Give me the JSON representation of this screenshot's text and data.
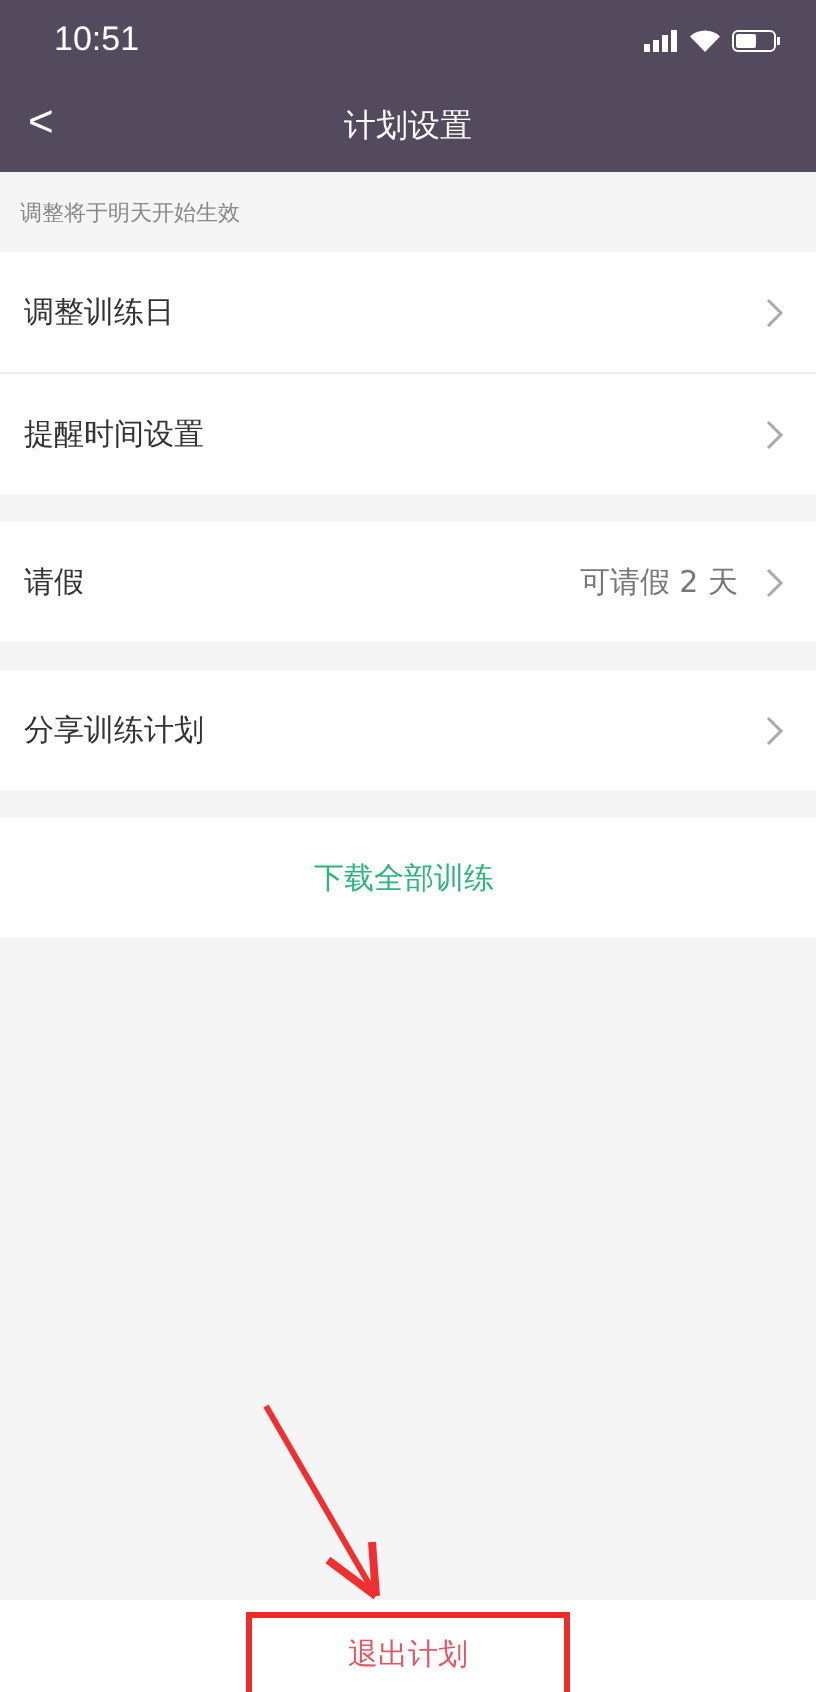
{
  "status_bar": {
    "time": "10:51"
  },
  "nav": {
    "back": "<",
    "title": "计划设置"
  },
  "notice": "调整将于明天开始生效",
  "groups": [
    {
      "rows": [
        {
          "kind": "nav",
          "label": "调整训练日"
        },
        {
          "kind": "nav",
          "label": "提醒时间设置"
        }
      ]
    },
    {
      "rows": [
        {
          "kind": "nav",
          "label": "请假",
          "value": "可请假 2 天"
        }
      ]
    },
    {
      "rows": [
        {
          "kind": "nav",
          "label": "分享训练计划"
        }
      ]
    },
    {
      "rows": [
        {
          "kind": "action",
          "label": "下载全部训练"
        }
      ]
    }
  ],
  "exit_button": {
    "label": "退出计划",
    "highlighted": true
  }
}
